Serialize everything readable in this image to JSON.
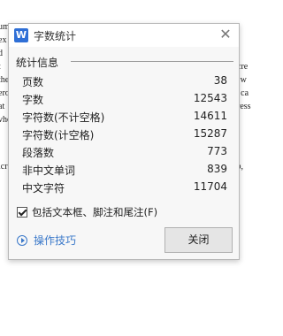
{
  "dialog": {
    "title": "字数统计",
    "app_icon_letter": "W",
    "close_glyph": "✕",
    "group_title": "统计信息",
    "stats": [
      {
        "label": "页数",
        "value": "38"
      },
      {
        "label": "字数",
        "value": "12543"
      },
      {
        "label": "字符数(不计空格)",
        "value": "14611"
      },
      {
        "label": "字符数(计空格)",
        "value": "15287"
      },
      {
        "label": "段落数",
        "value": "773"
      },
      {
        "label": "非中文单词",
        "value": "839"
      },
      {
        "label": "中文字符",
        "value": "11704"
      }
    ],
    "checkbox_label": "包括文本框、脚注和尾注(F)",
    "checkbox_checked": true,
    "tips_label": "操作技巧",
    "close_button_label": "关闭"
  },
  "background_doc": {
    "left_lines": [
      "um",
      "ex",
      "d",
      "t",
      "the",
      "ero",
      "at",
      "vho",
      "",
      "icr"
    ],
    "right_lines": [
      "is",
      "I",
      "e",
      "ncre",
      "It w",
      "is ca",
      "press",
      "",
      "",
      "ap,"
    ]
  }
}
